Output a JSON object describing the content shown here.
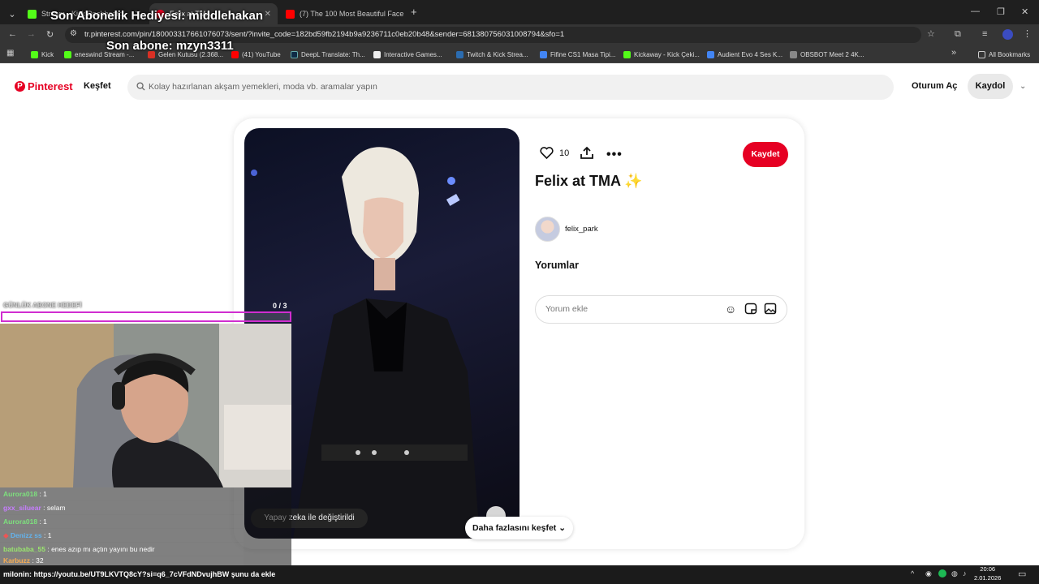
{
  "browser": {
    "tabs": [
      {
        "label": "Stream - Kick Dashboard"
      },
      {
        "label": "Felix at TMA"
      },
      {
        "label": "(7) The 100 Most Beautiful Face"
      }
    ],
    "new_tab": "+",
    "url": "tr.pinterest.com/pin/180003317661076073/sent/?invite_code=182bd59fb2194b9a9236711c0eb20b48&sender=681380756031008794&sfo=1",
    "bookmarks": [
      {
        "label": "Kick",
        "color": "#53fc18"
      },
      {
        "label": "eneswind Stream -...",
        "color": "#53fc18"
      },
      {
        "label": "Gelen Kutusu (2.368...",
        "color": "#d93025"
      },
      {
        "label": "(41) YouTube",
        "color": "#ff0000"
      },
      {
        "label": "DeepL Translate: Th...",
        "color": "#0f2b46"
      },
      {
        "label": "Interactive Games...",
        "color": "#eeeeee"
      },
      {
        "label": "Twitch & Kick Strea...",
        "color": "#2b6cb0"
      },
      {
        "label": "Fifine CS1 Masa Tipi...",
        "color": "#4285f4"
      },
      {
        "label": "Kickaway - Kick Çeki...",
        "color": "#53fc18"
      },
      {
        "label": "Audient Evo 4 Ses K...",
        "color": "#4285f4"
      },
      {
        "label": "OBSBOT Meet 2 4K...",
        "color": "#888888"
      }
    ],
    "all_bookmarks": "All Bookmarks",
    "more_bookmarks": "»"
  },
  "pinterest": {
    "logo": "Pinterest",
    "explore": "Keşfet",
    "search_placeholder": "Kolay hazırlanan akşam yemekleri, moda vb. aramalar yapın",
    "login": "Oturum Aç",
    "signup": "Kaydol",
    "brand_color": "#e60023"
  },
  "pin": {
    "likes": "10",
    "save": "Kaydet",
    "title": "Felix at TMA ✨",
    "author": "felix_park",
    "comments_heading": "Yorumlar",
    "comment_placeholder": "Yorum ekle",
    "ai_badge": "Yapay zeka ile değiştirildi",
    "explore_more": "Daha fazlasını keşfet"
  },
  "stream_overlay": {
    "last_gift": "Son Abonelik Hediyesi: middlehakan",
    "last_sub": "Son abone: mzyn3311",
    "goal_label": "GÜNLÜK ABONE HEDEFİ",
    "goal_count": "0 / 3",
    "goal_progress": 0
  },
  "chat": [
    {
      "user": "Aurora018",
      "msg": ": 1",
      "color": "#7de07d"
    },
    {
      "user": "gxx_siluear",
      "msg": ": selam",
      "color": "#c77dff"
    },
    {
      "user": "Aurora018",
      "msg": ": 1",
      "color": "#7de07d"
    },
    {
      "user": "Denizz ss",
      "msg": ": 1",
      "color": "#63b3ed"
    },
    {
      "user": "batubaba_55",
      "msg": ": enes azıp mı açtın yayını bu nedir",
      "color": "#9ae66e"
    },
    {
      "user": "Karbuzz",
      "msg": ": 32",
      "color": "#f6ad55"
    }
  ],
  "ticker": "milonin: https://youtu.be/UT9LKVTQ8cY?si=q6_7cVFdNDvujhBW şunu da ekle",
  "taskbar": {
    "time": "20:06",
    "date": "2.01.2026"
  }
}
